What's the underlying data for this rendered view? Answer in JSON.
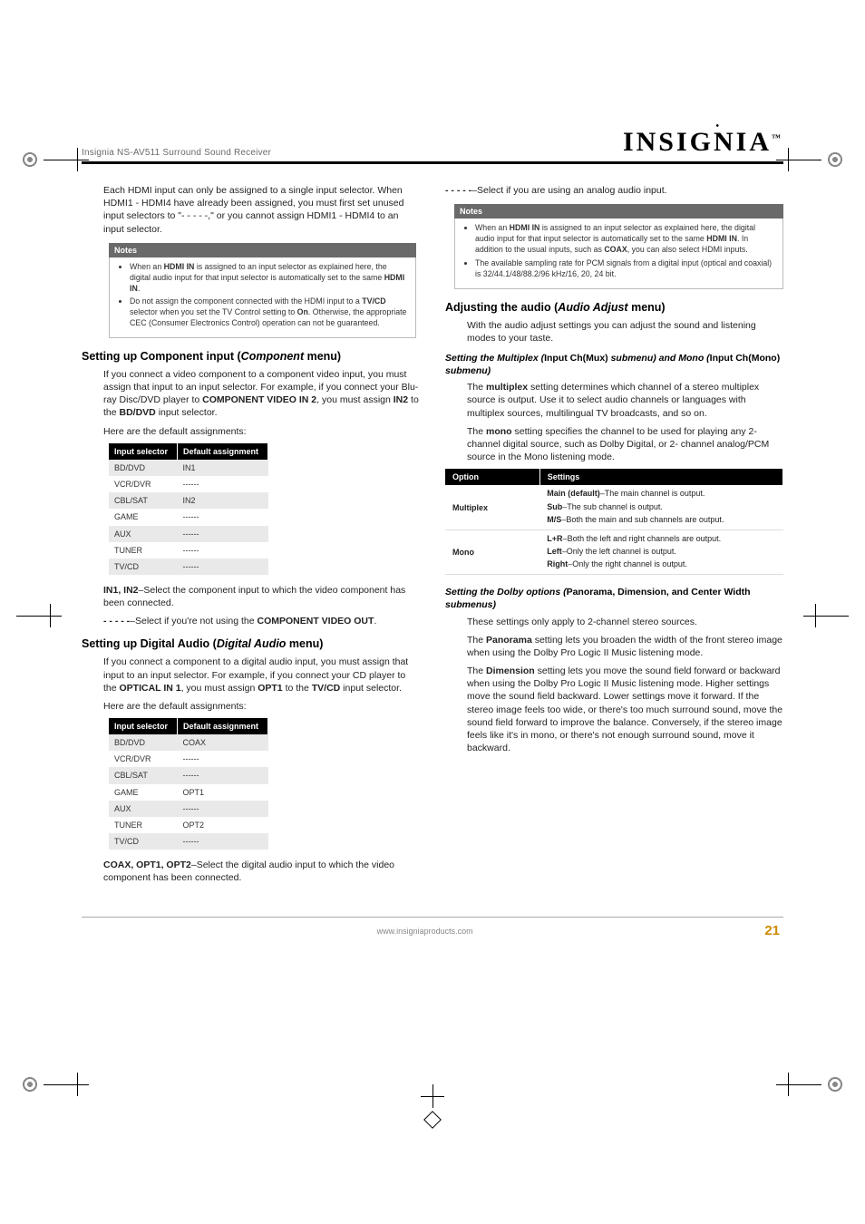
{
  "header": {
    "product_line": "Insignia NS-AV511 Surround Sound Receiver",
    "brand": "INSIGNIA",
    "brand_tm": "™"
  },
  "col_left": {
    "hdmi_intro": "Each HDMI input can only be assigned to a single input selector. When HDMI1 - HDMI4 have already been assigned, you must first set unused input selectors to \"- - - - -,\" or you cannot assign HDMI1 - HDMI4 to an input selector.",
    "notes1_title": "Notes",
    "notes1_items": [
      "When an HDMI IN is assigned to an input selector as explained here, the digital audio input for that input selector is automatically set to the same HDMI IN.",
      "Do not assign the component connected with the HDMI input to a TV/CD selector when you set the TV Control setting to On. Otherwise, the appropriate CEC (Consumer Electronics Control) operation can not be guaranteed."
    ],
    "h_component_pre": "Setting up Component input (",
    "h_component_ital": "Component",
    "h_component_post": " menu)",
    "component_p1": "If you connect a video component to a component video input, you must assign that input to an input selector. For example, if you connect your Blu-ray Disc/DVD player to COMPONENT VIDEO IN 2, you must assign IN2 to the BD/DVD input selector.",
    "component_p2": "Here are the default assignments:",
    "comp_table_h1": "Input selector",
    "comp_table_h2": "Default assignment",
    "comp_table_rows": [
      [
        "BD/DVD",
        "IN1"
      ],
      [
        "VCR/DVR",
        "------"
      ],
      [
        "CBL/SAT",
        "IN2"
      ],
      [
        "GAME",
        "------"
      ],
      [
        "AUX",
        "------"
      ],
      [
        "TUNER",
        "------"
      ],
      [
        "TV/CD",
        "------"
      ]
    ],
    "comp_after1_pre": "IN1, IN2",
    "comp_after1_post": "–Select the component input to which the video component has been connected.",
    "comp_after2_pre": "- - - - -",
    "comp_after2_mid": "–Select if you're not using the ",
    "comp_after2_bold": "COMPONENT VIDEO OUT",
    "comp_after2_post": ".",
    "h_digital_pre": "Setting up Digital Audio (",
    "h_digital_ital": "Digital Audio",
    "h_digital_post": " menu)",
    "digital_p1": "If you connect a component to a digital audio input, you must assign that input to an input selector. For example, if you connect your CD player to the OPTICAL IN 1, you must assign OPT1 to the TV/CD input selector.",
    "digital_p2": "Here are the default assignments:",
    "dig_table_rows": [
      [
        "BD/DVD",
        "COAX"
      ],
      [
        "VCR/DVR",
        "------"
      ],
      [
        "CBL/SAT",
        "------"
      ],
      [
        "GAME",
        "OPT1"
      ],
      [
        "AUX",
        "------"
      ],
      [
        "TUNER",
        "OPT2"
      ],
      [
        "TV/CD",
        "------"
      ]
    ],
    "dig_after_pre": "COAX, OPT1, OPT2",
    "dig_after_post": "–Select the digital audio input to which the video component has been connected."
  },
  "col_right": {
    "analog_line_pre": "- - - - -",
    "analog_line_post": "–Select if you are using an analog audio input.",
    "notes2_title": "Notes",
    "notes2_items": [
      "When an HDMI IN is assigned to an input selector as explained here, the digital audio input for that input selector is automatically set to the same HDMI IN. In addition to the usual inputs, such as COAX, you can also select HDMI inputs.",
      "The available sampling rate for PCM signals from a digital input (optical and coaxial) is 32/44.1/48/88.2/96 kHz/16, 20, 24 bit."
    ],
    "h_adjust_pre": "Adjusting the audio (",
    "h_adjust_ital": "Audio Adjust",
    "h_adjust_post": " menu)",
    "adjust_p1": "With the audio adjust settings you can adjust the sound and listening modes to your taste.",
    "h_mux_pre": "Setting the Multiplex (",
    "h_mux_b1": "Input Ch(Mux)",
    "h_mux_mid": " submenu) and Mono (",
    "h_mux_b2": "Input Ch(Mono)",
    "h_mux_post": " submenu)",
    "mux_p1_a": "The ",
    "mux_p1_b": "multiplex",
    "mux_p1_c": " setting determines which channel of a stereo multiplex source is output. Use it to select audio channels or languages with multiplex sources, multilingual TV broadcasts, and so on.",
    "mux_p2_a": "The ",
    "mux_p2_b": "mono",
    "mux_p2_c": " setting specifies the channel to be used for playing any 2-channel digital source, such as Dolby Digital, or 2- channel analog/PCM source in the Mono listening mode.",
    "opt_table_h1": "Option",
    "opt_table_h2": "Settings",
    "opt_row1_label": "Multiplex",
    "opt_row1_lines": [
      [
        "Main (default)",
        "–The main channel is output."
      ],
      [
        "Sub",
        "–The sub channel is output."
      ],
      [
        "M/S",
        "–Both the main and sub channels are output."
      ]
    ],
    "opt_row2_label": "Mono",
    "opt_row2_lines": [
      [
        "L+R",
        "–Both the left and right channels are output."
      ],
      [
        "Left",
        "–Only the left channel is output."
      ],
      [
        "Right",
        "–Only the right channel is output."
      ]
    ],
    "h_dolby_pre": "Setting the Dolby options (",
    "h_dolby_b": "Panorama, Dimension, and Center Width",
    "h_dolby_post": " submenus)",
    "dolby_p1": "These settings only apply to 2-channel stereo sources.",
    "dolby_p2_a": "The ",
    "dolby_p2_b": "Panorama",
    "dolby_p2_c": " setting lets you broaden the width of the front stereo image when using the Dolby Pro Logic II Music listening mode.",
    "dolby_p3_a": "The ",
    "dolby_p3_b": "Dimension",
    "dolby_p3_c": " setting lets you move the sound field forward or backward when using the Dolby Pro Logic II Music listening mode. Higher settings move the sound field backward. Lower settings move it forward. If the stereo image feels too wide, or there's too much surround sound, move the sound field forward to improve the balance. Conversely, if the stereo image feels like it's in mono, or there's not enough surround sound, move it backward."
  },
  "footer": {
    "url": "www.insigniaproducts.com",
    "page": "21"
  }
}
